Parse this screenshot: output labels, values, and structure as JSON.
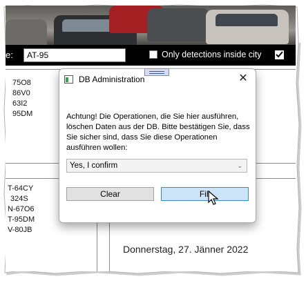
{
  "toolbar": {
    "field_label": "e:",
    "plate_value": "AT-95",
    "only_inside_city_label": "Only detections inside city",
    "only_inside_city_checked": false,
    "second_checkbox_checked": true
  },
  "background": {
    "plates_top": [
      "75O8",
      "86V0",
      "63I2",
      "95DM"
    ],
    "plates_bottom": [
      "T-64CY",
      "324S",
      "N-67O6",
      "T-95DM",
      "V-80JB"
    ],
    "date_text": "Donnerstag, 27. Jänner 2022"
  },
  "dialog": {
    "title": "DB Administration",
    "close_glyph": "✕",
    "message": "Achtung! Die Operationen, die Sie hier ausführen, löschen Daten aus der DB. Bitte bestätigen Sie, dass Sie sicher sind, dass Sie diese Operationen ausführen wollen:",
    "confirm_select_value": "Yes, I confirm",
    "clear_label": "Clear",
    "fill_label": "Fill"
  },
  "colors": {
    "toolbar_bg": "#000000",
    "fill_button_bg": "#cce4f7",
    "fill_button_border": "#3f86d8"
  }
}
